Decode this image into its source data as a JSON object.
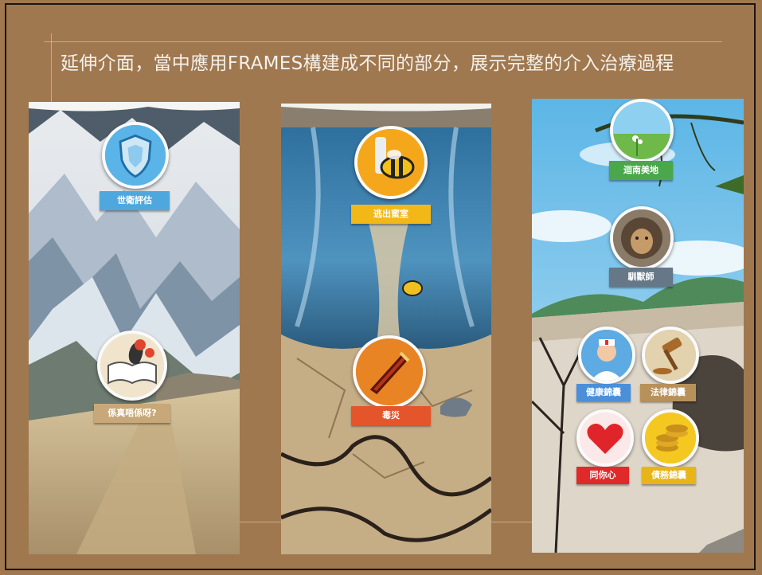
{
  "slide": {
    "title": "延伸介面，當中應用FRAMES構建成不同的部分，展示完整的介入治療過程"
  },
  "panels": [
    {
      "theme": "mountain",
      "nodes": [
        {
          "label": "世衛評估",
          "icon": "shield-icon",
          "color": "#4ea8de"
        },
        {
          "label": "係真唔係呀?",
          "icon": "book-question-icon",
          "color": "#c8a878"
        }
      ]
    },
    {
      "theme": "waterfall",
      "nodes": [
        {
          "label": "逃出蜜室",
          "icon": "bee-icon",
          "color": "#f2b818"
        },
        {
          "label": "毒災",
          "icon": "sword-icon",
          "color": "#e4552c"
        }
      ]
    },
    {
      "theme": "savanna",
      "nodes": [
        {
          "label": "迴南美地",
          "icon": "meadow-icon",
          "color": "#4aa84a"
        },
        {
          "label": "馴獸師",
          "icon": "lion-icon",
          "color": "#667788"
        },
        {
          "label": "健康錦囊",
          "icon": "nurse-icon",
          "color": "#4a8fd8"
        },
        {
          "label": "法律錦囊",
          "icon": "gavel-icon",
          "color": "#b8905a"
        },
        {
          "label": "同你心",
          "icon": "heart-icon",
          "color": "#e02a2a"
        },
        {
          "label": "債務錦囊",
          "icon": "coins-icon",
          "color": "#e8b418"
        }
      ]
    }
  ]
}
